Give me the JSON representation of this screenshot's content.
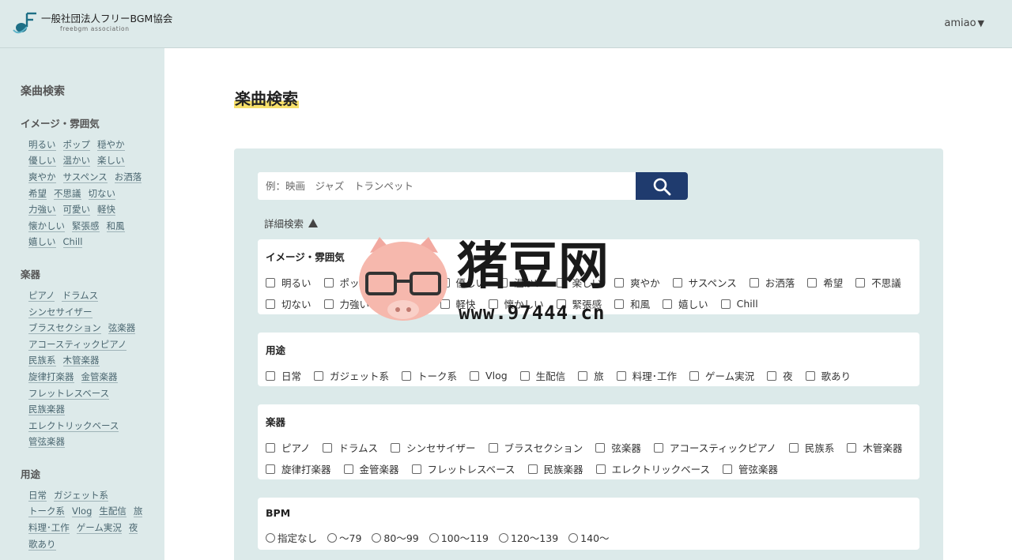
{
  "header": {
    "logo_title": "一般社団法人フリーBGM協会",
    "logo_subtitle": "freebgm association",
    "user_name": "amiao",
    "user_caret": "▼"
  },
  "sidebar": {
    "title": "楽曲検索",
    "sections": [
      {
        "title": "イメージ・雰囲気",
        "rows": [
          [
            "明るい",
            "ポップ",
            "穏やか"
          ],
          [
            "優しい",
            "温かい",
            "楽しい"
          ],
          [
            "爽やか",
            "サスペンス",
            "お洒落"
          ],
          [
            "希望",
            "不思議",
            "切ない"
          ],
          [
            "力強い",
            "可愛い",
            "軽快"
          ],
          [
            "懐かしい",
            "緊張感",
            "和風"
          ],
          [
            "嬉しい",
            "Chill"
          ]
        ]
      },
      {
        "title": "楽器",
        "rows": [
          [
            "ピアノ",
            "ドラムス"
          ],
          [
            "シンセサイザー"
          ],
          [
            "ブラスセクション",
            "弦楽器"
          ],
          [
            "アコースティックピアノ"
          ],
          [
            "民族系",
            "木管楽器"
          ],
          [
            "旋律打楽器",
            "金管楽器"
          ],
          [
            "フレットレスベース"
          ],
          [
            "民族楽器"
          ],
          [
            "エレクトリックベース"
          ],
          [
            "管弦楽器"
          ]
        ]
      },
      {
        "title": "用途",
        "rows": [
          [
            "日常",
            "ガジェット系"
          ],
          [
            "トーク系",
            "Vlog",
            "生配信",
            "旅"
          ],
          [
            "料理･工作",
            "ゲーム実況",
            "夜"
          ],
          [
            "歌あり"
          ]
        ]
      }
    ]
  },
  "main": {
    "title": "楽曲検索",
    "search": {
      "placeholder": "例：映画　ジャズ　トランペット"
    },
    "advanced_label": "詳細検索",
    "filters": {
      "mood": {
        "title": "イメージ・雰囲気",
        "rows": [
          [
            "明るい",
            "ポップ",
            "穏やか",
            "優しい",
            "温かい",
            "楽しい",
            "爽やか",
            "サスペンス",
            "お洒落",
            "希望",
            "不思議"
          ],
          [
            "切ない",
            "力強い",
            "可愛い",
            "軽快",
            "懐かしい",
            "緊張感",
            "和風",
            "嬉しい",
            "Chill"
          ]
        ]
      },
      "usage": {
        "title": "用途",
        "rows": [
          [
            "日常",
            "ガジェット系",
            "トーク系",
            "Vlog",
            "生配信",
            "旅",
            "料理･工作",
            "ゲーム実況",
            "夜",
            "歌あり"
          ]
        ]
      },
      "instrument": {
        "title": "楽器",
        "rows": [
          [
            "ピアノ",
            "ドラムス",
            "シンセサイザー",
            "ブラスセクション",
            "弦楽器",
            "アコースティックピアノ",
            "民族系",
            "木管楽器"
          ],
          [
            "旋律打楽器",
            "金管楽器",
            "フレットレスベース",
            "民族楽器",
            "エレクトリックベース",
            "管弦楽器"
          ]
        ]
      },
      "bpm": {
        "title": "BPM",
        "options": [
          "指定なし",
          "〜79",
          "80〜99",
          "100〜119",
          "120〜139",
          "140〜"
        ]
      }
    }
  },
  "watermark": {
    "text": "猪豆网",
    "url": "www.97444.cn"
  },
  "colors": {
    "header_bg": "#ddeaea",
    "panel_bg": "#dceaea",
    "search_button": "#1f3b6e",
    "title_highlight": "#f7e06a"
  }
}
